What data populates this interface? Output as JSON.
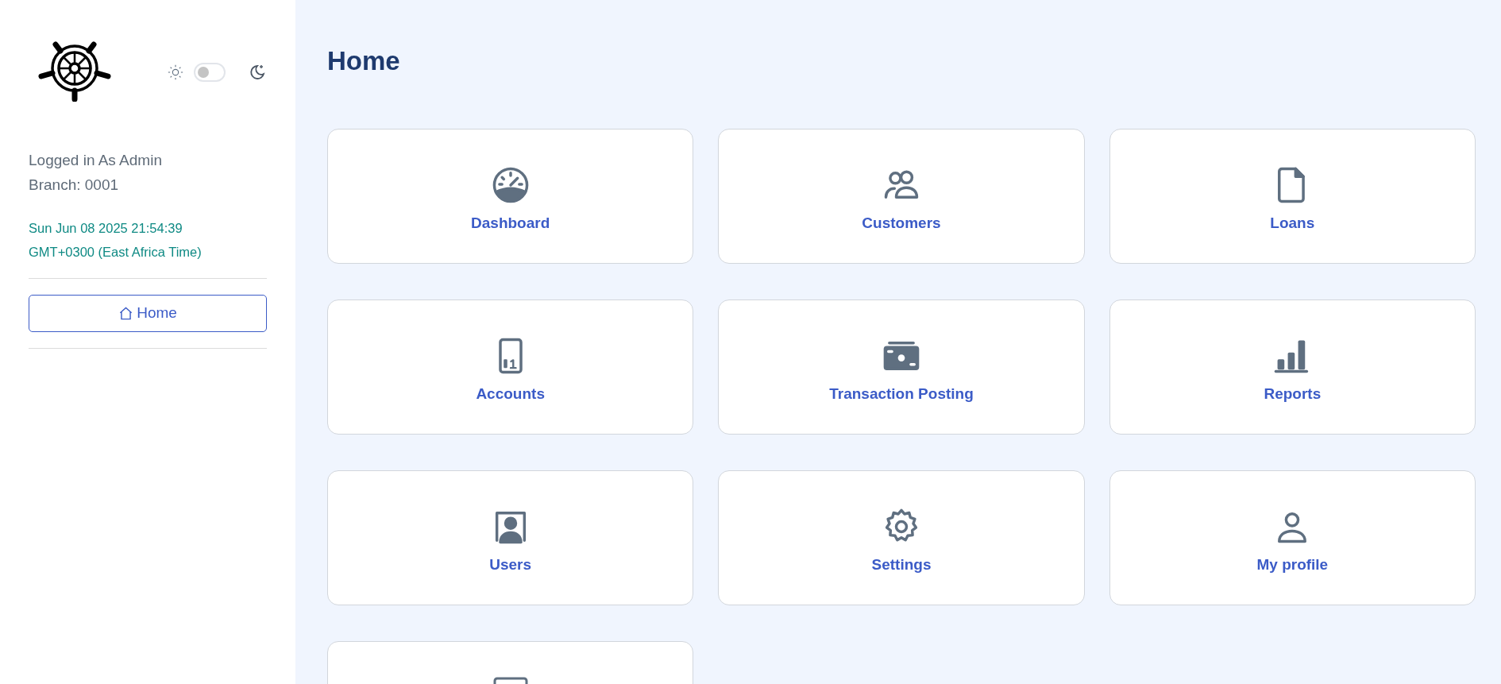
{
  "theme_toggle": {
    "dark_mode": false
  },
  "user": {
    "login_text": "Logged in As Admin",
    "branch": "Branch: 0001"
  },
  "clock": {
    "date_line": "Sun Jun 08 2025 21:54:39",
    "zone_line": "GMT+0300 (East Africa Time)"
  },
  "nav": [
    {
      "label": "Home",
      "selected": true
    }
  ],
  "page_title": "Home",
  "tiles": [
    {
      "kind": "dashboard",
      "label": "Dashboard"
    },
    {
      "kind": "customers",
      "label": "Customers"
    },
    {
      "kind": "loans",
      "label": "Loans"
    },
    {
      "kind": "accounts",
      "label": "Accounts"
    },
    {
      "kind": "transactions",
      "label": "Transaction Posting"
    },
    {
      "kind": "reports",
      "label": "Reports"
    },
    {
      "kind": "users",
      "label": "Users"
    },
    {
      "kind": "settings",
      "label": "Settings"
    },
    {
      "kind": "profile",
      "label": "My profile"
    },
    {
      "kind": "partial"
    }
  ]
}
